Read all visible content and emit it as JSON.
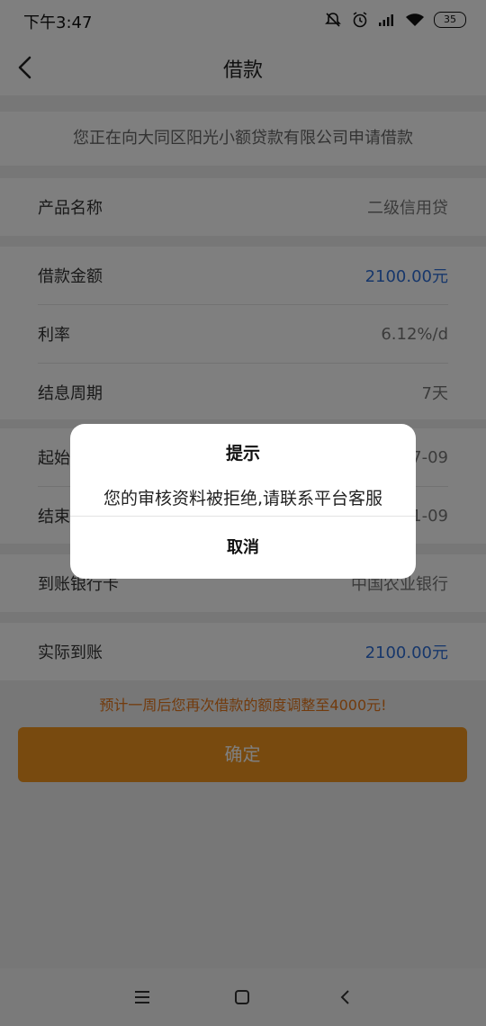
{
  "status_bar": {
    "time": "下午3:47",
    "battery": "35",
    "icons": [
      "mute-icon",
      "alarm-icon",
      "signal-icon",
      "wifi-icon",
      "battery-icon"
    ]
  },
  "header": {
    "title": "借款",
    "back_icon": "chevron-left-icon"
  },
  "notice": "您正在向大同区阳光小额贷款有限公司申请借款",
  "product": {
    "label": "产品名称",
    "value": "二级信用贷"
  },
  "loan": {
    "amount_label": "借款金额",
    "amount_value": "2100.00元",
    "rate_label": "利率",
    "rate_value": "6.12%/d",
    "period_label": "结息周期",
    "period_value": "7天"
  },
  "dates": {
    "start_label": "起始",
    "start_value": "7-09",
    "end_label": "结束",
    "end_value": "1-09"
  },
  "bank": {
    "label": "到账银行卡",
    "value": "中国农业银行"
  },
  "actual": {
    "label": "实际到账",
    "value": "2100.00元"
  },
  "tip": "预计一周后您再次借款的额度调整至4000元!",
  "confirm_label": "确定",
  "dialog": {
    "title": "提示",
    "message": "您的审核资料被拒绝,请联系平台客服",
    "cancel_label": "取消"
  },
  "nav": {
    "icons": [
      "menu-icon",
      "home-icon",
      "back-icon"
    ]
  },
  "colors": {
    "accent_blue": "#2f6fd6",
    "tip_orange": "#e5761a",
    "button_orange": "#f0951e"
  }
}
